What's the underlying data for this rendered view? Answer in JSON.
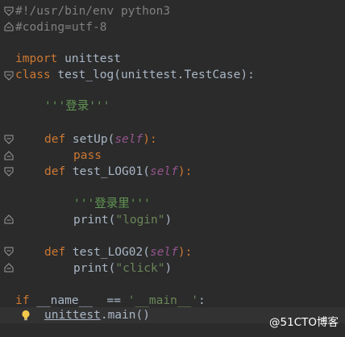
{
  "code": {
    "l1": "#!/usr/bin/env python3",
    "l2": "#coding=utf-8",
    "l4_kw": "import",
    "l4_rest": " unittest",
    "l5_kw": "class",
    "l5_rest": " test_log(unittest.TestCase):",
    "l7_doc": "'''登录'''",
    "l9_kw": "def",
    "l9_name": " setUp(",
    "l9_self": "self",
    "l9_end": "):",
    "l10_kw": "pass",
    "l11_kw": "def",
    "l11_name": " test_LOG01(",
    "l11_self": "self",
    "l11_end": "):",
    "l13_doc": "'''登录里'''",
    "l14_fn": "print(",
    "l14_str": "\"login\"",
    "l14_end": ")",
    "l16_kw": "def",
    "l16_name": " test_LOG02(",
    "l16_self": "self",
    "l16_end": "):",
    "l17_fn": "print(",
    "l17_str": "\"click\"",
    "l17_end": ")",
    "l19_kw": "if",
    "l19_rest": " __name__  == ",
    "l19_str": "'__main__'",
    "l19_end": ":",
    "l20_mod": "unittest",
    "l20_rest": ".main()"
  },
  "watermark": "@51CTO博客",
  "colors": {
    "background": "#2b2b2b",
    "keyword": "#cc7832",
    "comment": "#808080",
    "string": "#6a8759",
    "self": "#94558d",
    "text": "#a9b7c6"
  },
  "icons": [
    "fold-marker-icon",
    "lightbulb-icon"
  ]
}
